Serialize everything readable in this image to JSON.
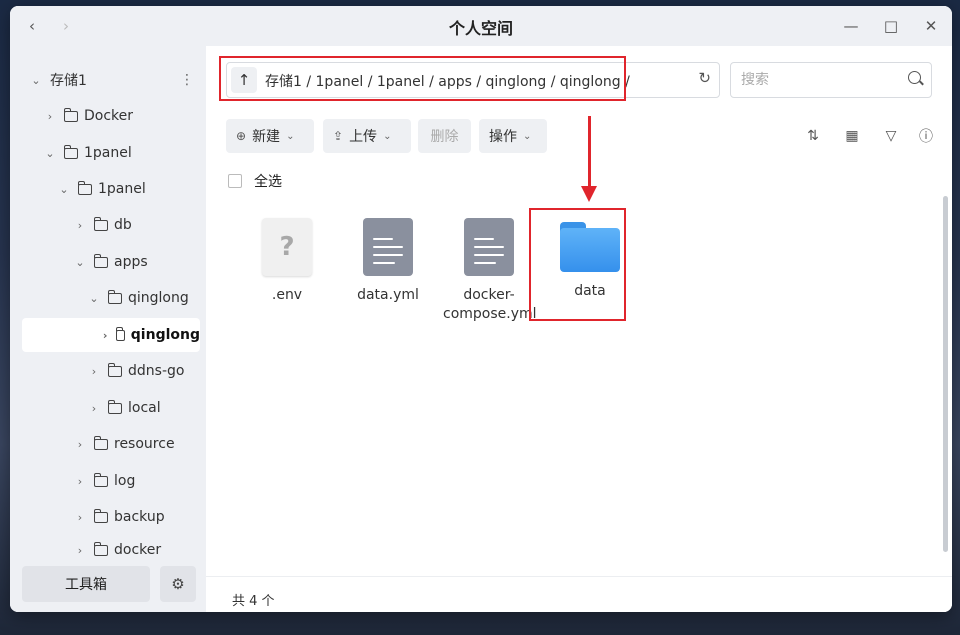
{
  "window": {
    "title": "个人空间"
  },
  "nav": {
    "back": "‹",
    "forward": "›"
  },
  "controls": {
    "minimize": "—",
    "maximize": "□",
    "close": "✕"
  },
  "sidebar": {
    "storage": "存储1",
    "items": [
      {
        "label": "Docker"
      },
      {
        "label": "1panel"
      },
      {
        "label": "1panel"
      },
      {
        "label": "db"
      },
      {
        "label": "apps"
      },
      {
        "label": "qinglong"
      },
      {
        "label": "qinglong"
      },
      {
        "label": "ddns-go"
      },
      {
        "label": "local"
      },
      {
        "label": "resource"
      },
      {
        "label": "log"
      },
      {
        "label": "backup"
      },
      {
        "label": "docker"
      }
    ],
    "toolbox_label": "工具箱"
  },
  "pathbar": {
    "path": "存储1 / 1panel / 1panel / apps / qinglong / qinglong /"
  },
  "search": {
    "placeholder": "搜索"
  },
  "toolbar": {
    "new_label": "新建",
    "upload_label": "上传",
    "delete_label": "删除",
    "action_label": "操作"
  },
  "select_all": "全选",
  "files": [
    {
      "name": ".env",
      "icon": "unknown-file-icon"
    },
    {
      "name": "data.yml",
      "icon": "text-file-icon"
    },
    {
      "name": "docker-compose.yml",
      "icon": "text-file-icon"
    },
    {
      "name": "data",
      "icon": "folder-icon"
    }
  ],
  "docker_compose_lines": [
    "docker-",
    "compose.yml"
  ],
  "status": {
    "count_text": "共 4 个"
  },
  "colors": {
    "accent_red": "#e0252c",
    "folder_blue": "#3590ec"
  }
}
